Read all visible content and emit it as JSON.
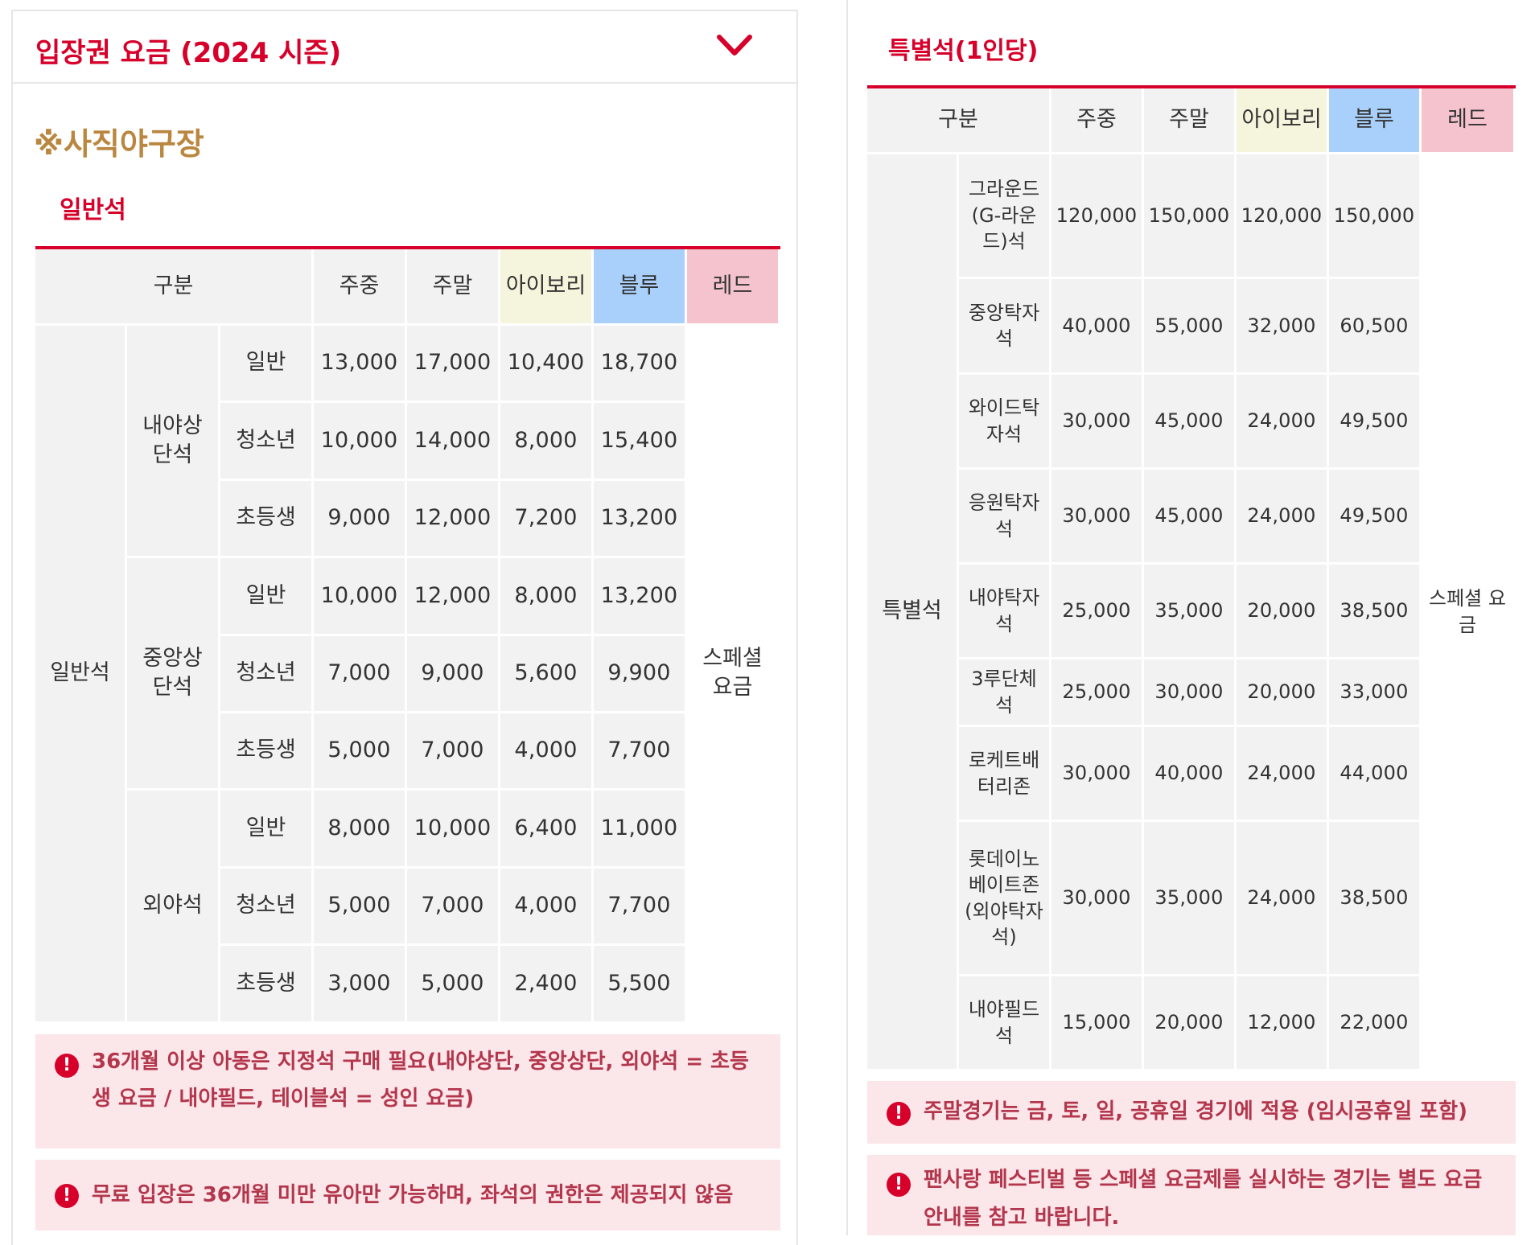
{
  "left": {
    "accordion_title": "입장권 요금 (2024 시즌)",
    "venue": "※사직야구장",
    "section_title": "일반석",
    "headers": {
      "category": "구분",
      "weekday": "주중",
      "weekend": "주말",
      "ivory": "아이보리",
      "blue": "블루",
      "red": "레드"
    },
    "group_label": "일반석",
    "red_value": "스페셜 요금",
    "zones": [
      {
        "name": "내야상단석",
        "rows": [
          {
            "type": "일반",
            "weekday": "13,000",
            "weekend": "17,000",
            "ivory": "10,400",
            "blue": "18,700"
          },
          {
            "type": "청소년",
            "weekday": "10,000",
            "weekend": "14,000",
            "ivory": "8,000",
            "blue": "15,400"
          },
          {
            "type": "초등생",
            "weekday": "9,000",
            "weekend": "12,000",
            "ivory": "7,200",
            "blue": "13,200"
          }
        ]
      },
      {
        "name": "중앙상단석",
        "rows": [
          {
            "type": "일반",
            "weekday": "10,000",
            "weekend": "12,000",
            "ivory": "8,000",
            "blue": "13,200"
          },
          {
            "type": "청소년",
            "weekday": "7,000",
            "weekend": "9,000",
            "ivory": "5,600",
            "blue": "9,900"
          },
          {
            "type": "초등생",
            "weekday": "5,000",
            "weekend": "7,000",
            "ivory": "4,000",
            "blue": "7,700"
          }
        ]
      },
      {
        "name": "외야석",
        "rows": [
          {
            "type": "일반",
            "weekday": "8,000",
            "weekend": "10,000",
            "ivory": "6,400",
            "blue": "11,000"
          },
          {
            "type": "청소년",
            "weekday": "5,000",
            "weekend": "7,000",
            "ivory": "4,000",
            "blue": "7,700"
          },
          {
            "type": "초등생",
            "weekday": "3,000",
            "weekend": "5,000",
            "ivory": "2,400",
            "blue": "5,500"
          }
        ]
      }
    ],
    "notices": [
      "36개월 이상 아동은 지정석 구매 필요(내야상단, 중앙상단, 외야석 = 초등생 요금 / 내야필드, 테이블석 = 성인 요금)",
      "무료 입장은 36개월 미만 유아만 가능하며, 좌석의 권한은 제공되지 않음"
    ]
  },
  "right": {
    "section_title": "특별석(1인당)",
    "headers": {
      "category": "구분",
      "weekday": "주중",
      "weekend": "주말",
      "ivory": "아이보리",
      "blue": "블루",
      "red": "레드"
    },
    "group_label": "특별석",
    "red_value": "스페셜 요금",
    "rows": [
      {
        "seat": "그라운드(G-라운드)석",
        "weekday": "120,000",
        "weekend": "150,000",
        "ivory": "120,000",
        "blue": "150,000"
      },
      {
        "seat": "중앙탁자석",
        "weekday": "40,000",
        "weekend": "55,000",
        "ivory": "32,000",
        "blue": "60,500"
      },
      {
        "seat": "와이드탁자석",
        "weekday": "30,000",
        "weekend": "45,000",
        "ivory": "24,000",
        "blue": "49,500"
      },
      {
        "seat": "응원탁자석",
        "weekday": "30,000",
        "weekend": "45,000",
        "ivory": "24,000",
        "blue": "49,500"
      },
      {
        "seat": "내야탁자석",
        "weekday": "25,000",
        "weekend": "35,000",
        "ivory": "20,000",
        "blue": "38,500"
      },
      {
        "seat": "3루단체석",
        "weekday": "25,000",
        "weekend": "30,000",
        "ivory": "20,000",
        "blue": "33,000"
      },
      {
        "seat": "로케트배터리존",
        "weekday": "30,000",
        "weekend": "40,000",
        "ivory": "24,000",
        "blue": "44,000"
      },
      {
        "seat": "롯데이노베이트존(외야탁자석)",
        "weekday": "30,000",
        "weekend": "35,000",
        "ivory": "24,000",
        "blue": "38,500"
      },
      {
        "seat": "내야필드석",
        "weekday": "15,000",
        "weekend": "20,000",
        "ivory": "12,000",
        "blue": "22,000"
      }
    ],
    "notices": [
      "주말경기는 금, 토, 일, 공휴일 경기에 적용 (임시공휴일 포함)",
      "팬사랑 페스티벌 등 스페셜 요금제를 실시하는 경기는 별도 요금 안내를 참고 바랍니다."
    ]
  },
  "icons": {
    "chevron": "chevron-down-icon",
    "notice": "exclamation-circle-icon"
  },
  "colors": {
    "accent": "#d6002a",
    "venue": "#b9873f",
    "ivory": "#f5f4dc",
    "blue": "#a9d0fb",
    "red": "#f4c3cd",
    "notice_bg": "#fbe6ea"
  }
}
